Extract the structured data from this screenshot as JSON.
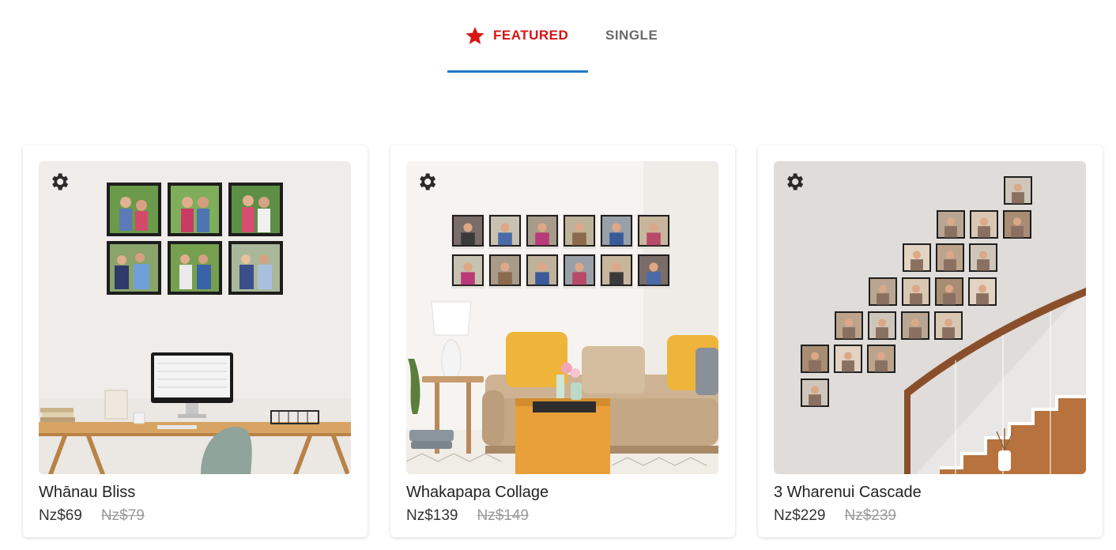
{
  "tabs": [
    {
      "label": "FEATURED",
      "icon": "star-icon",
      "active": true,
      "color": "#d81414"
    },
    {
      "label": "SINGLE",
      "icon": "",
      "active": false
    }
  ],
  "accent": "#1f78c8",
  "products": [
    {
      "title": "Whānau Bliss",
      "price": "Nz$69",
      "old_price": "Nz$79",
      "icon": "gear-icon"
    },
    {
      "title": "Whakapapa Collage",
      "price": "Nz$139",
      "old_price": "Nz$149",
      "icon": "gear-icon"
    },
    {
      "title": "3 Wharenui Cascade",
      "price": "Nz$229",
      "old_price": "Nz$239",
      "icon": "gear-icon"
    }
  ]
}
